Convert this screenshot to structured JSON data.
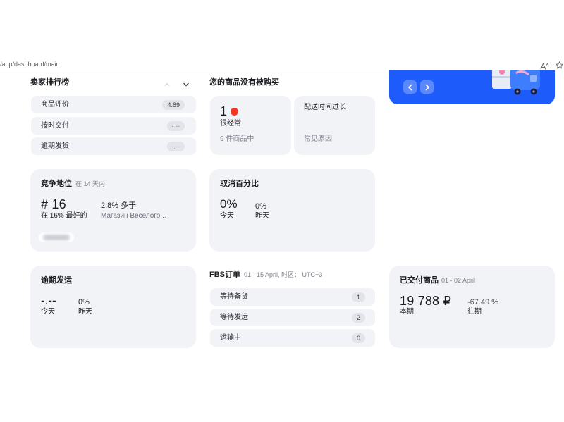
{
  "theme": {
    "accent": "#1d5bfa",
    "card_bg": "#f2f3f7",
    "alert": "#f5351c"
  },
  "browser": {
    "url": "/app/dashboard/main",
    "icons": {
      "reader": "text-size-icon",
      "bookmark": "star-icon"
    }
  },
  "promo_banner": {
    "prev_icon": "chevron-left-icon",
    "next_icon": "chevron-right-icon"
  },
  "seller_rating": {
    "title": "卖家排行榜",
    "icons": {
      "collapse": "chevron-up-icon",
      "expand": "chevron-down-icon"
    },
    "items": [
      {
        "label": "商品评价",
        "value": "4.89"
      },
      {
        "label": "按时交付",
        "value": "-.--"
      },
      {
        "label": "逾期发货",
        "value": "-.--"
      }
    ]
  },
  "not_bought": {
    "title": "您的商品没有被购买",
    "count": "1",
    "frequency": "很经常",
    "of_items": "9 件商品中",
    "reason": "配送时间过长",
    "reason_caption": "常见原因"
  },
  "competitive_position": {
    "title": "竞争地位",
    "period": "在 14 天内",
    "rank": "# 16",
    "rank_caption": "在 16% 最好的",
    "diff": "2.8% 多于",
    "competitor": "Магазин Веселого..."
  },
  "cancellation": {
    "title": "取消百分比",
    "today_value": "0%",
    "today_label": "今天",
    "yesterday_value": "0%",
    "yesterday_label": "昨天"
  },
  "late_shipment": {
    "title": "逾期发运",
    "today_value": "-.--",
    "today_label": "今天",
    "yesterday_value": "0%",
    "yesterday_label": "昨天"
  },
  "fbs_orders": {
    "title": "FBS订单",
    "period": "01 - 15 April, 时区： UTC+3",
    "items": [
      {
        "label": "等待备货",
        "count": "1"
      },
      {
        "label": "等待发运",
        "count": "2"
      },
      {
        "label": "运输中",
        "count": "0"
      }
    ]
  },
  "delivered": {
    "title": "已交付商品",
    "period": "01 - 02 April",
    "current_value": "19 788 ₽",
    "current_label": "本期",
    "change": "-67.49 %",
    "previous_label": "往期"
  }
}
